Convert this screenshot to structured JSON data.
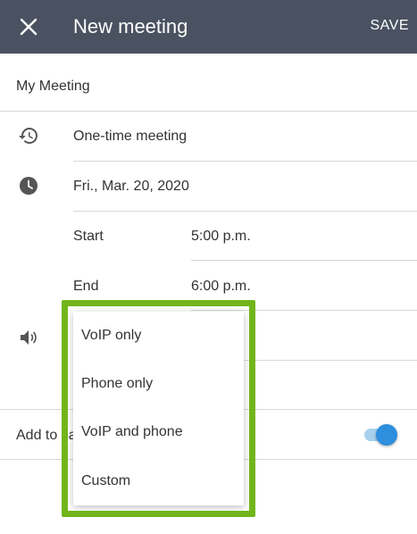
{
  "header": {
    "title": "New meeting",
    "save_label": "SAVE"
  },
  "form": {
    "meeting_title": "My Meeting",
    "recurrence": "One-time meeting",
    "date": "Fri., Mar. 20, 2020",
    "start_label": "Start",
    "start_time": "5:00 p.m.",
    "end_label": "End",
    "end_time": "6:00 p.m.",
    "add_to_calendar_label_visible": "Add to ca",
    "add_to_calendar_enabled": true
  },
  "audio_menu": {
    "options": [
      "VoIP only",
      "Phone only",
      "VoIP and phone",
      "Custom"
    ]
  },
  "colors": {
    "header_bg": "#4a5261",
    "highlight": "#71b51b",
    "toggle": "#2d8fde"
  }
}
